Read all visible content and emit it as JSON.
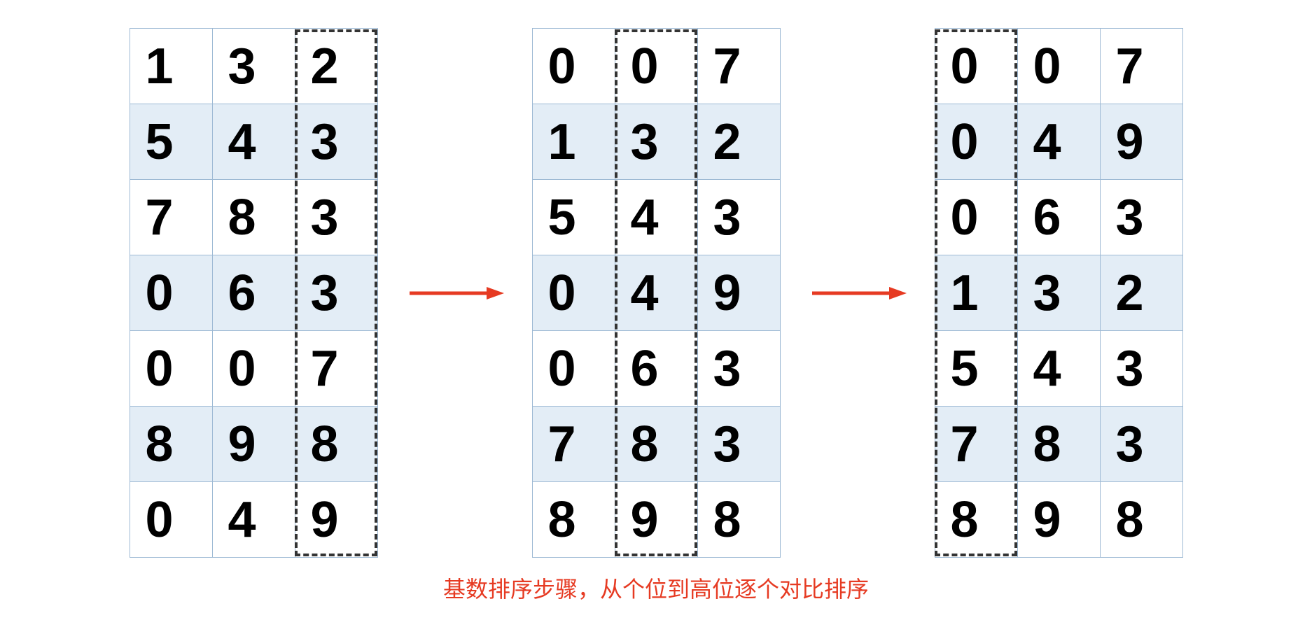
{
  "tables": [
    {
      "id": "table1",
      "highlight_column": 2,
      "rows": [
        {
          "shaded": false,
          "digits": [
            "1",
            "3",
            "2"
          ]
        },
        {
          "shaded": true,
          "digits": [
            "5",
            "4",
            "3"
          ]
        },
        {
          "shaded": false,
          "digits": [
            "7",
            "8",
            "3"
          ]
        },
        {
          "shaded": true,
          "digits": [
            "0",
            "6",
            "3"
          ]
        },
        {
          "shaded": false,
          "digits": [
            "0",
            "0",
            "7"
          ]
        },
        {
          "shaded": true,
          "digits": [
            "8",
            "9",
            "8"
          ]
        },
        {
          "shaded": false,
          "digits": [
            "0",
            "4",
            "9"
          ]
        }
      ]
    },
    {
      "id": "table2",
      "highlight_column": 1,
      "rows": [
        {
          "shaded": false,
          "digits": [
            "0",
            "0",
            "7"
          ]
        },
        {
          "shaded": true,
          "digits": [
            "1",
            "3",
            "2"
          ]
        },
        {
          "shaded": false,
          "digits": [
            "5",
            "4",
            "3"
          ]
        },
        {
          "shaded": true,
          "digits": [
            "0",
            "4",
            "9"
          ]
        },
        {
          "shaded": false,
          "digits": [
            "0",
            "6",
            "3"
          ]
        },
        {
          "shaded": true,
          "digits": [
            "7",
            "8",
            "3"
          ]
        },
        {
          "shaded": false,
          "digits": [
            "8",
            "9",
            "8"
          ]
        }
      ]
    },
    {
      "id": "table3",
      "highlight_column": 0,
      "rows": [
        {
          "shaded": false,
          "digits": [
            "0",
            "0",
            "7"
          ]
        },
        {
          "shaded": true,
          "digits": [
            "0",
            "4",
            "9"
          ]
        },
        {
          "shaded": false,
          "digits": [
            "0",
            "6",
            "3"
          ]
        },
        {
          "shaded": true,
          "digits": [
            "1",
            "3",
            "2"
          ]
        },
        {
          "shaded": false,
          "digits": [
            "5",
            "4",
            "3"
          ]
        },
        {
          "shaded": true,
          "digits": [
            "7",
            "8",
            "3"
          ]
        },
        {
          "shaded": false,
          "digits": [
            "8",
            "9",
            "8"
          ]
        }
      ]
    }
  ],
  "caption": "基数排序步骤，从个位到高位逐个对比排序",
  "colors": {
    "arrow": "#e63a22",
    "cell_border": "#9db9d4",
    "shaded_bg": "#e3edf6"
  }
}
